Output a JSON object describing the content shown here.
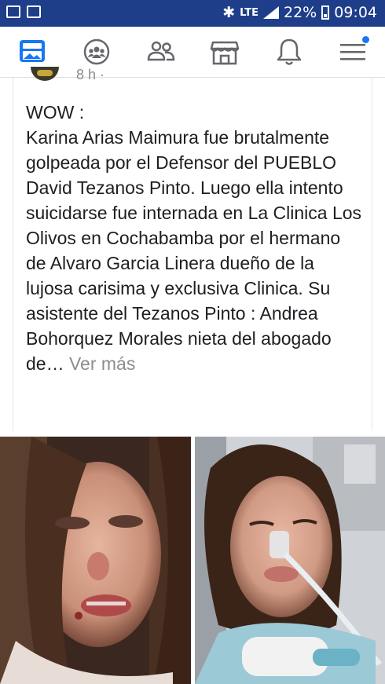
{
  "status_bar": {
    "icons_left": [
      "gallery-icon",
      "voicemail-icon"
    ],
    "network": "LTE",
    "battery": "22%",
    "time": "09:04"
  },
  "nav": {
    "items": [
      "news-feed-icon",
      "groups-icon",
      "friends-icon",
      "marketplace-icon",
      "notifications-icon",
      "menu-icon"
    ],
    "accent": "#1877f2"
  },
  "post": {
    "meta": "8 h ·",
    "text": "WOW :\nKarina Arias Maimura fue brutalmente golpeada por el Defensor del PUEBLO David Tezanos Pinto. Luego ella intento suicidarse fue internada en La Clinica Los Olivos en Cochabamba por el hermano de Alvaro Garcia Linera dueño de la lujosa carisima y exclusiva Clinica. Su asistente del Tezanos Pinto : Andrea Bohorquez Morales nieta del abogado de…",
    "see_more": "Ver más"
  },
  "photos": [
    "photo-left",
    "photo-right"
  ]
}
